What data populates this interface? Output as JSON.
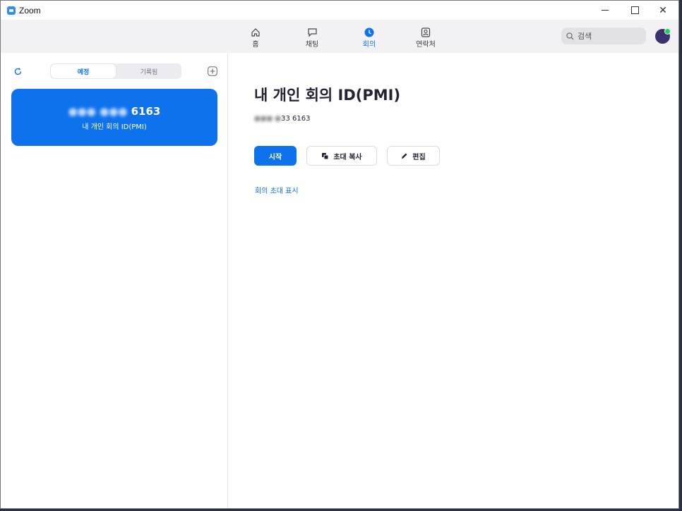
{
  "window": {
    "title": "Zoom"
  },
  "nav": {
    "tabs": [
      {
        "label": "홈",
        "icon": "home-icon"
      },
      {
        "label": "채팅",
        "icon": "chat-icon"
      },
      {
        "label": "회의",
        "icon": "meeting-clock-icon",
        "active": true
      },
      {
        "label": "연락처",
        "icon": "contacts-icon"
      }
    ],
    "search_label": "검색"
  },
  "left": {
    "segments": [
      "예정",
      "기록됨"
    ],
    "card": {
      "number_visible": "6163",
      "label": "내 개인 회의 ID(PMI)"
    }
  },
  "main": {
    "title": "내 개인 회의 ID(PMI)",
    "id_visible": "33 6163",
    "buttons": {
      "start": "시작",
      "copy_invitation": "초대 복사",
      "edit": "편집"
    },
    "show_invitation": "회의 초대 표시"
  },
  "colors": {
    "accent": "#0e72ed",
    "presence": "#1cd15c"
  }
}
